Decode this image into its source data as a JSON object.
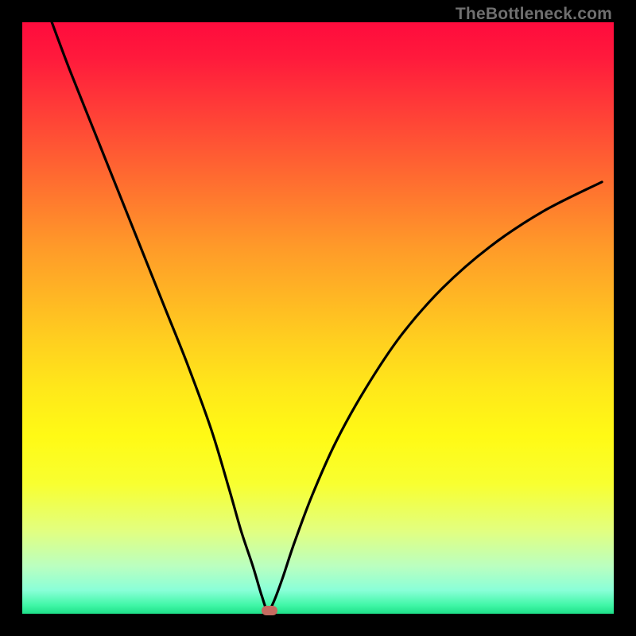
{
  "watermark": "TheBottleneck.com",
  "chart_data": {
    "type": "line",
    "title": "",
    "xlabel": "",
    "ylabel": "",
    "xlim": [
      0,
      100
    ],
    "ylim": [
      0,
      100
    ],
    "grid": false,
    "series": [
      {
        "name": "curve",
        "x": [
          5,
          8,
          12,
          16,
          20,
          24,
          28,
          32,
          35,
          37,
          39,
          40.5,
          41.5,
          42.5,
          44,
          46,
          49,
          53,
          58,
          64,
          71,
          79,
          88,
          98
        ],
        "y": [
          100,
          92,
          82,
          72,
          62,
          52,
          42,
          31,
          21,
          14,
          8,
          3,
          0.5,
          2,
          6,
          12,
          20,
          29,
          38,
          47,
          55,
          62,
          68,
          73
        ]
      }
    ],
    "marker": {
      "x": 41.8,
      "y": 0.6,
      "color": "#c66a60"
    }
  }
}
